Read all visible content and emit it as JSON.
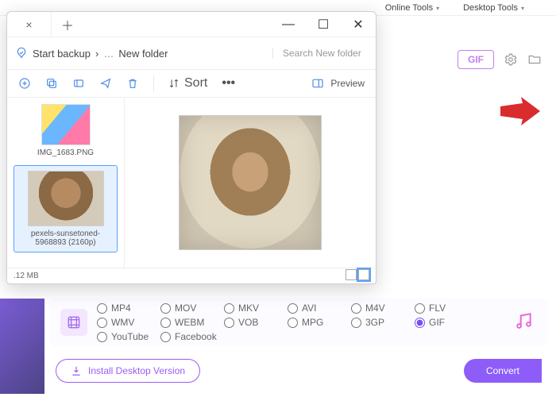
{
  "menubar": {
    "online": "Online Tools",
    "desktop": "Desktop Tools"
  },
  "header": {
    "gif": "GIF"
  },
  "explorer": {
    "breadcrumb": {
      "label": "Start backup",
      "folder": "New folder"
    },
    "search_placeholder": "Search New folder",
    "sort": "Sort",
    "preview": "Preview",
    "files": [
      {
        "name": "IMG_1683.PNG"
      },
      {
        "name": "pexels-sunsetoned-5968893 (2160p)"
      }
    ],
    "footer": ".12 MB"
  },
  "formats": {
    "row1": [
      "MP4",
      "MOV",
      "MKV",
      "AVI",
      "M4V",
      "FLV",
      "WMV"
    ],
    "row2": [
      "WEBM",
      "VOB",
      "MPG",
      "3GP",
      "GIF",
      "YouTube",
      "Facebook"
    ],
    "selected": "GIF"
  },
  "buttons": {
    "install": "Install Desktop Version",
    "convert": "Convert"
  }
}
